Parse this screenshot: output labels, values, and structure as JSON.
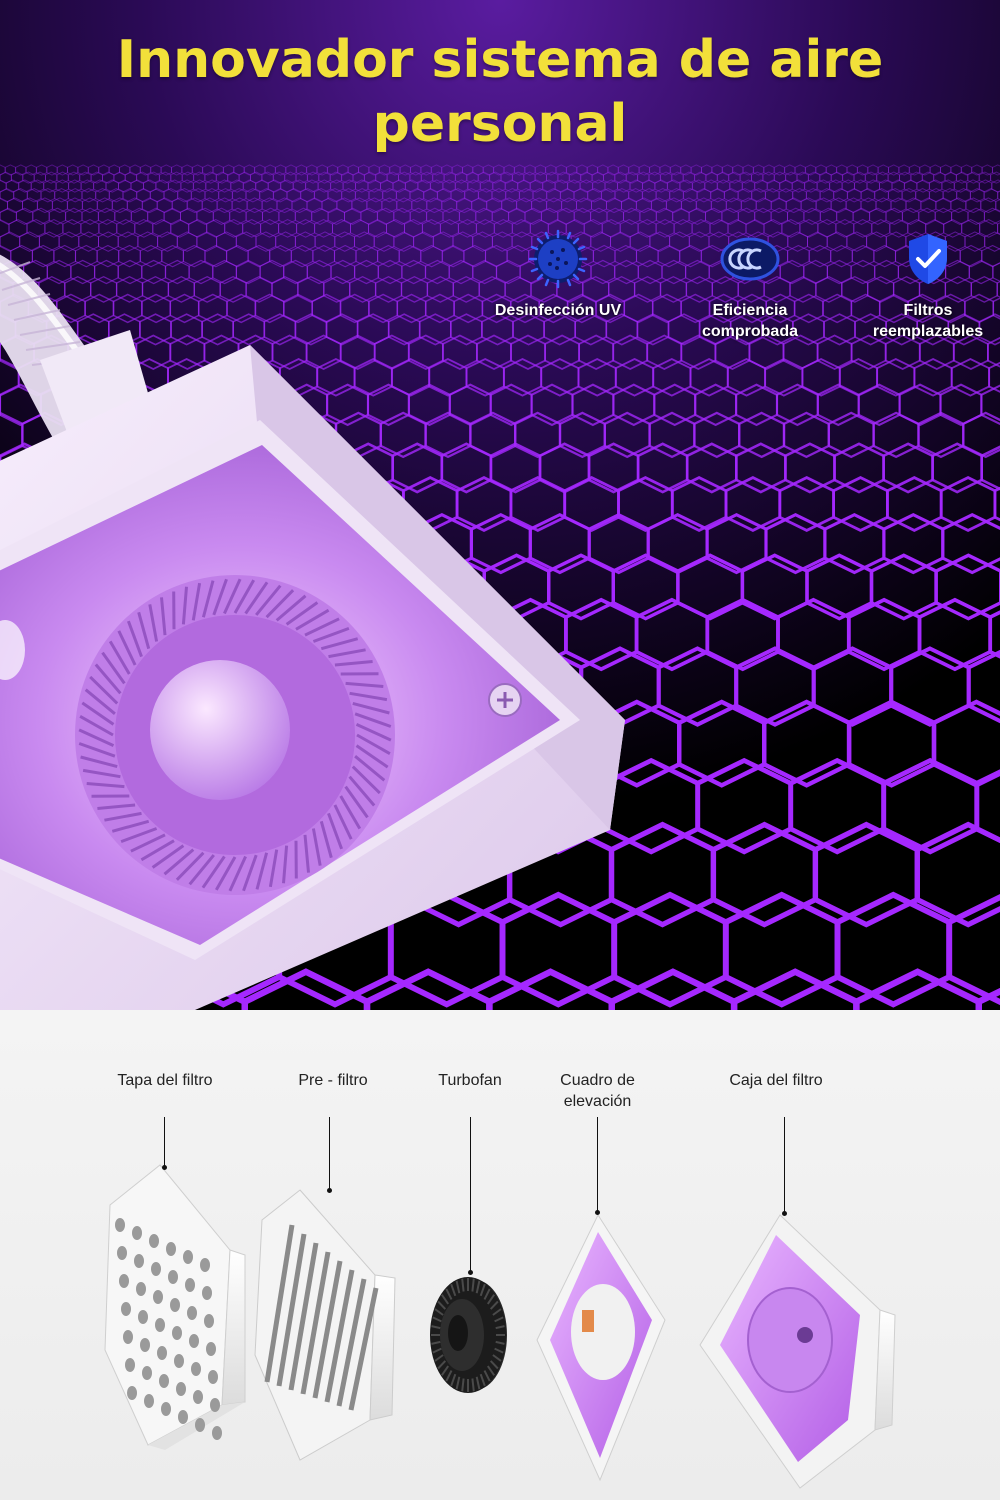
{
  "hero": {
    "title_line1": "Innovador sistema de aire",
    "title_line2": "personal",
    "accent_color": "#f2e03a",
    "grid_color": "#a528ff",
    "features": [
      {
        "icon": "virus-icon",
        "label": "Desinfección UV"
      },
      {
        "icon": "ccc-certification-icon",
        "label": "Eficiencia comprobada"
      },
      {
        "icon": "shield-check-icon",
        "label": "Filtros reemplazables"
      }
    ]
  },
  "components": [
    {
      "label": "Tapa del filtro"
    },
    {
      "label": "Pre - filtro"
    },
    {
      "label": "Turbofan"
    },
    {
      "label": "Cuadro de elevación"
    },
    {
      "label": "Caja del filtro"
    }
  ]
}
